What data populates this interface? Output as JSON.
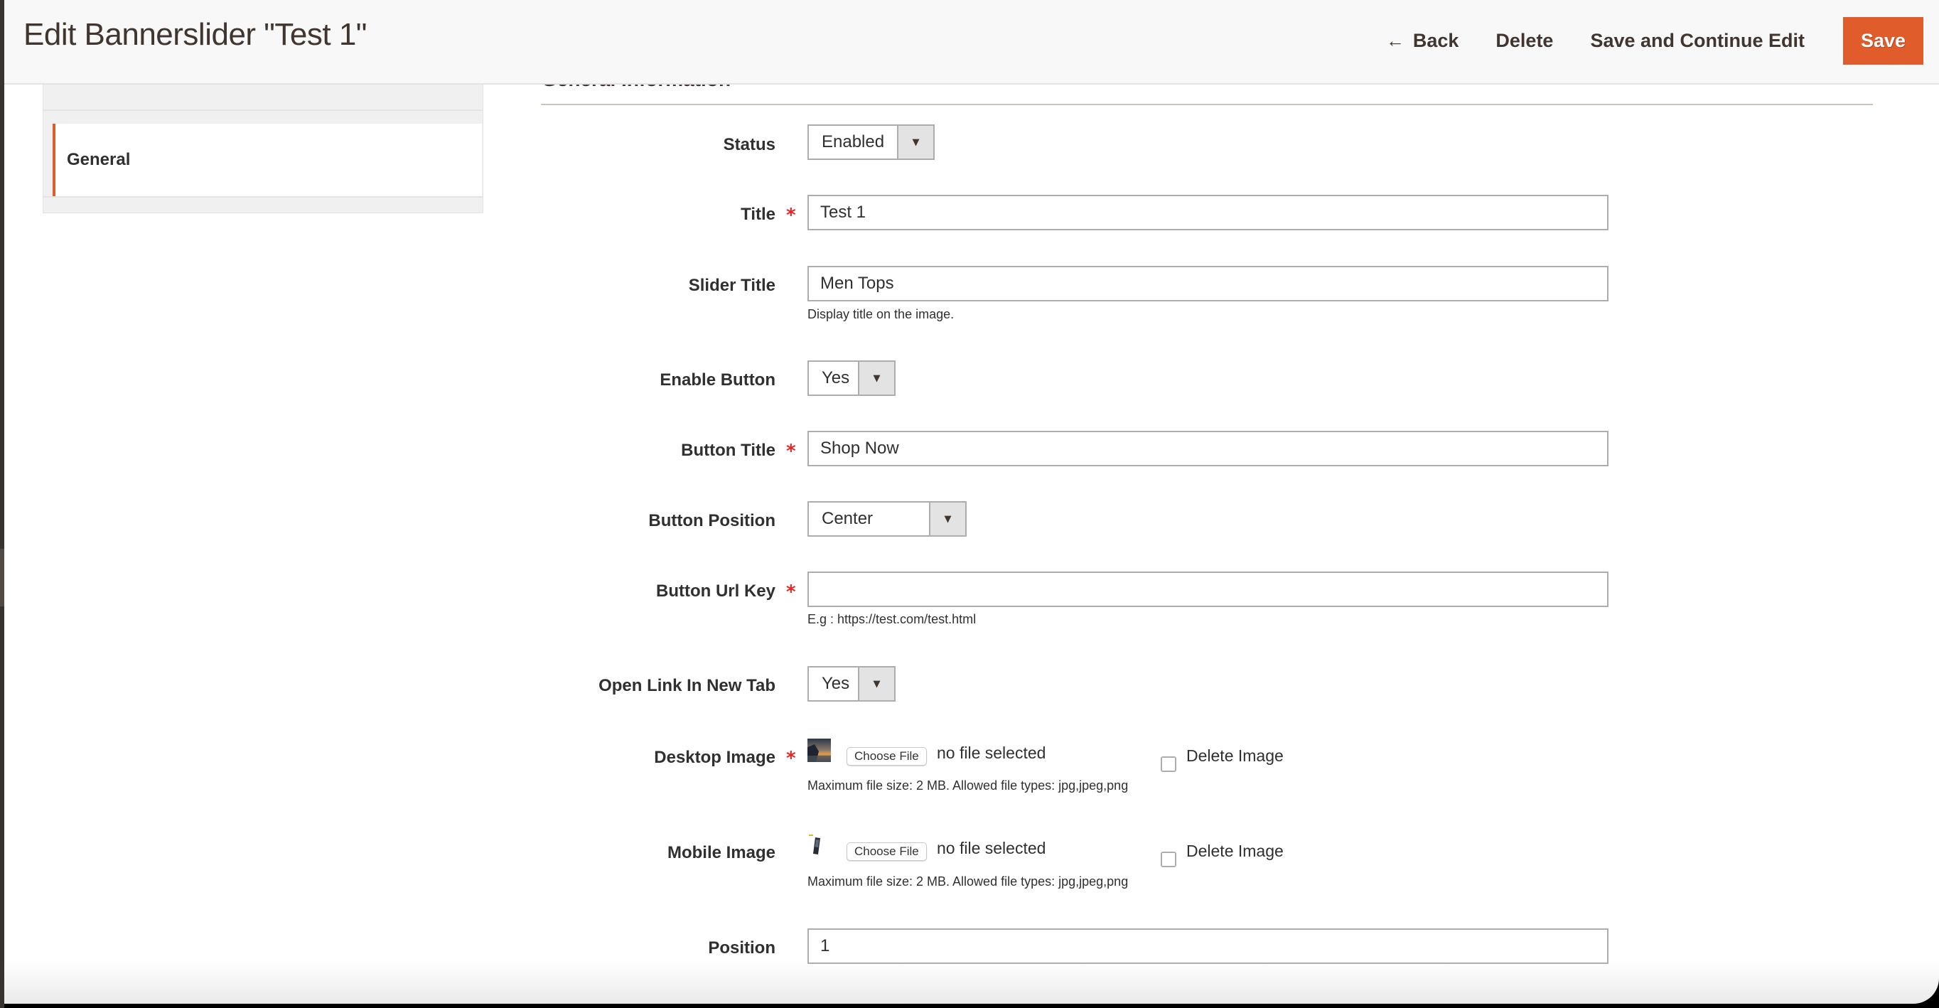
{
  "header": {
    "title": "Edit Bannerslider \"Test 1\"",
    "actions": {
      "back": "Back",
      "delete": "Delete",
      "save_continue": "Save and Continue Edit",
      "save": "Save"
    }
  },
  "sidebar": {
    "items": [
      {
        "label": "General",
        "active": true
      }
    ]
  },
  "section": {
    "title": "General Information"
  },
  "form": {
    "status": {
      "label": "Status",
      "value": "Enabled"
    },
    "title": {
      "label": "Title",
      "value": "Test 1",
      "required": true
    },
    "slider_title": {
      "label": "Slider Title",
      "value": "Men Tops",
      "note": "Display title on the image."
    },
    "enable_button": {
      "label": "Enable Button",
      "value": "Yes"
    },
    "button_title": {
      "label": "Button Title",
      "value": "Shop Now",
      "required": true
    },
    "button_position": {
      "label": "Button Position",
      "value": "Center"
    },
    "button_url_key": {
      "label": "Button Url Key",
      "value": "",
      "required": true,
      "note": "E.g : https://test.com/test.html"
    },
    "open_new_tab": {
      "label": "Open Link In New Tab",
      "value": "Yes"
    },
    "desktop_image": {
      "label": "Desktop Image",
      "required": true,
      "choose_label": "Choose File",
      "file_status": "no file selected",
      "delete_label": "Delete Image",
      "delete_checked": false,
      "note": "Maximum file size: 2 MB. Allowed file types: jpg,jpeg,png"
    },
    "mobile_image": {
      "label": "Mobile Image",
      "choose_label": "Choose File",
      "file_status": "no file selected",
      "delete_label": "Delete Image",
      "delete_checked": false,
      "note": "Maximum file size: 2 MB. Allowed file types: jpg,jpeg,png"
    },
    "position": {
      "label": "Position",
      "value": "1"
    },
    "required_marker": "*"
  },
  "colors": {
    "accent": "#e05c2a",
    "required": "#e22626",
    "header_bg": "#f8f8f8",
    "sidebar_bg": "#f0f0f0"
  }
}
